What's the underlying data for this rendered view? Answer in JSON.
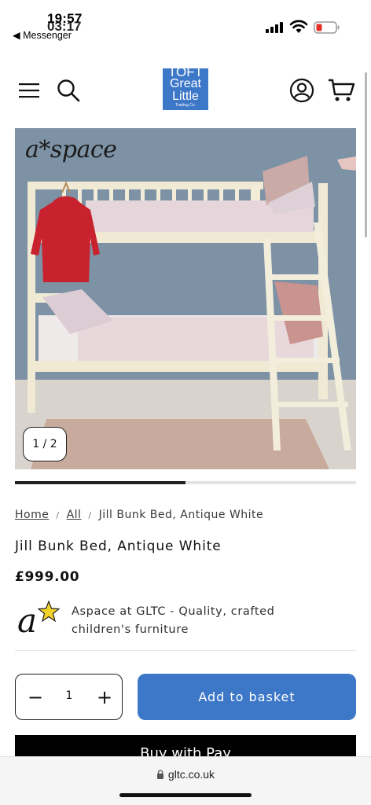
{
  "status_bar": {
    "time": "19:57",
    "time_overlay": "03:17",
    "back_app_label": "◀ Messenger"
  },
  "header": {
    "logo": {
      "line1": "TOFT",
      "line2": "Great",
      "line3": "Little",
      "line4": "Trading Co."
    },
    "icons": [
      "menu-icon",
      "search-icon",
      "account-icon",
      "cart-icon"
    ]
  },
  "gallery": {
    "brand_mark": "a*space",
    "counter": "1 / 2",
    "current_slide": 1,
    "total_slides": 2
  },
  "breadcrumb": {
    "home": "Home",
    "all": "All",
    "current": "Jill Bunk Bed, Antique White",
    "separator": "/"
  },
  "product": {
    "title": "Jill Bunk Bed, Antique White",
    "price": "£999.00",
    "brand_badge": "a",
    "brand_description": "Aspace at GLTC - Quality, crafted children's furniture"
  },
  "quantity": {
    "minus_label": "−",
    "value": "1",
    "plus_label": "+"
  },
  "actions": {
    "add_to_basket": "Add to basket",
    "buy_now": "Buy with  Pay"
  },
  "browser": {
    "url": "gltc.co.uk"
  },
  "colors": {
    "brand_blue": "#3c77c8",
    "text": "#121212",
    "wall": "#7f93a4"
  }
}
